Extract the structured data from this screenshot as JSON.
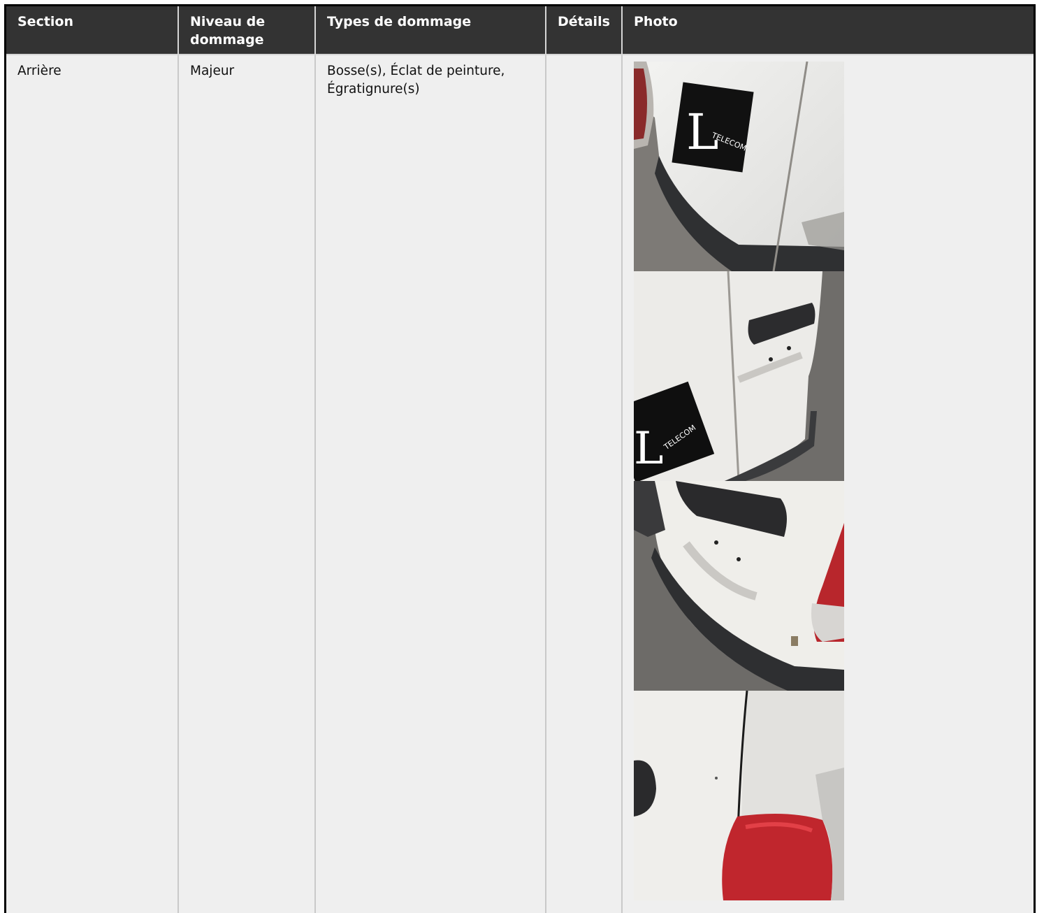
{
  "table": {
    "headers": {
      "section": "Section",
      "level": "Niveau de dommage",
      "types": "Types de dommage",
      "details": "Détails",
      "photo": "Photo"
    },
    "rows": [
      {
        "section": "Arrière",
        "level": "Majeur",
        "types": "Bosse(s), Éclat de peinture, Égratignure(s)",
        "details": "",
        "photos": [
          {
            "logo_text": "TELECOM",
            "logo_letter": "L"
          },
          {
            "logo_text": "TELECOM",
            "logo_letter": "L"
          },
          {},
          {}
        ]
      }
    ]
  },
  "colors": {
    "header_bg": "#333333",
    "header_text": "#ffffff",
    "cell_bg": "#efefef",
    "frame": "#000000"
  }
}
